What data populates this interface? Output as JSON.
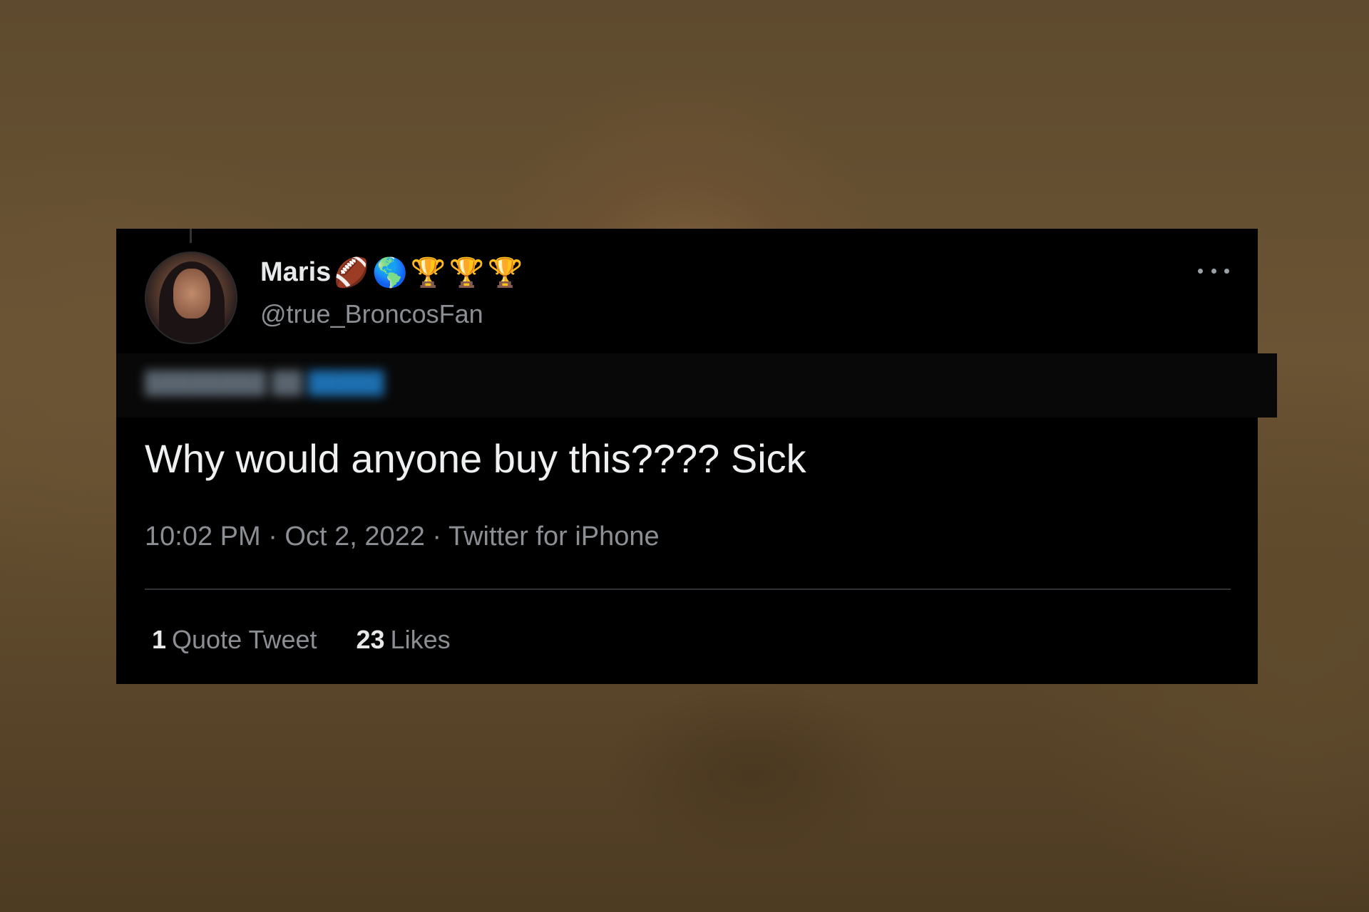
{
  "tweet": {
    "display_name": "Maris",
    "name_emojis": [
      "🏈",
      "🌎",
      "🏆",
      "🏆",
      "🏆"
    ],
    "handle": "@true_BroncosFan",
    "text": "Why would anyone buy this???? Sick",
    "meta": "10:02 PM · Oct 2, 2022 · Twitter for iPhone",
    "stats": {
      "quote_count": "1",
      "quote_label": "Quote Tweet",
      "like_count": "23",
      "like_label": "Likes"
    }
  },
  "colors": {
    "card_background": "#000000",
    "primary_text": "#e7e9ea",
    "secondary_text": "#8b8f94",
    "divider": "#2f3336"
  },
  "icons": [
    "more-options-icon",
    "avatar"
  ]
}
